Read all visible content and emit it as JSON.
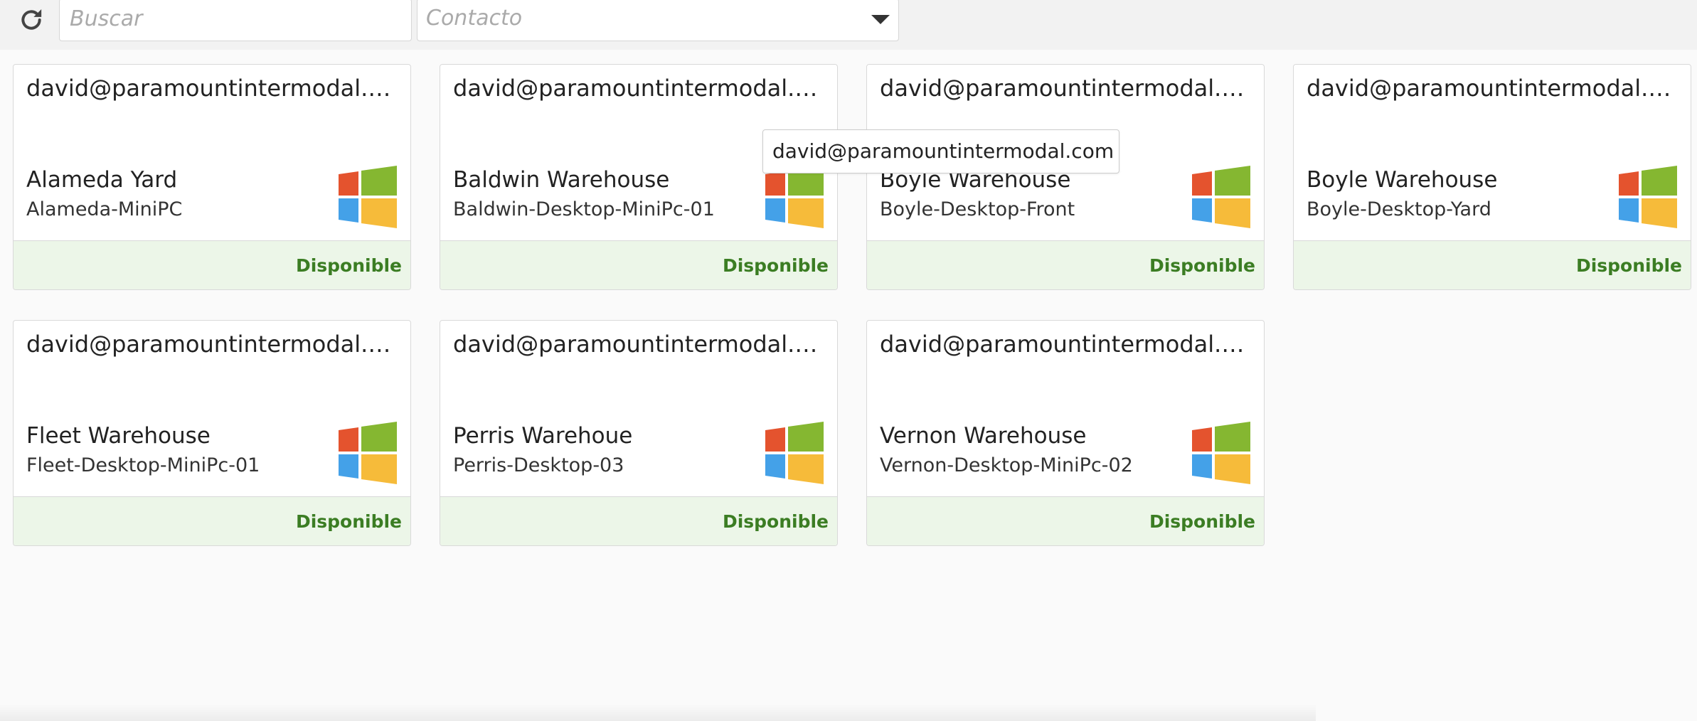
{
  "toolbar": {
    "refresh_icon": "refresh-icon",
    "search": {
      "placeholder": "Buscar",
      "value": ""
    },
    "contact_select": {
      "value": "Contacto",
      "icon": "chevron-down-icon"
    }
  },
  "tooltip": {
    "text": "david@paramountintermodal.com"
  },
  "colors": {
    "status_green": "#3b7d23",
    "footer_bg": "#ecf6e8",
    "win_red": "#e4532e",
    "win_green": "#85b731",
    "win_blue": "#44a1e8",
    "win_yellow": "#f6bb3a"
  },
  "devices": [
    {
      "email": "david@paramountintermodal.com",
      "location": "Alameda Yard",
      "hostname": "Alameda-MiniPC",
      "os_icon": "windows-icon",
      "status": "Disponible"
    },
    {
      "email": "david@paramountintermodal.com",
      "location": "Baldwin Warehouse",
      "hostname": "Baldwin-Desktop-MiniPc-01",
      "os_icon": "windows-icon",
      "status": "Disponible"
    },
    {
      "email": "david@paramountintermodal.com",
      "location": "Boyle Warehouse",
      "hostname": "Boyle-Desktop-Front",
      "os_icon": "windows-icon",
      "status": "Disponible"
    },
    {
      "email": "david@paramountintermodal.com",
      "location": "Boyle Warehouse",
      "hostname": "Boyle-Desktop-Yard",
      "os_icon": "windows-icon",
      "status": "Disponible"
    },
    {
      "email": "david@paramountintermodal.com",
      "location": "Fleet Warehouse",
      "hostname": "Fleet-Desktop-MiniPc-01",
      "os_icon": "windows-icon",
      "status": "Disponible"
    },
    {
      "email": "david@paramountintermodal.com",
      "location": "Perris Warehoue",
      "hostname": "Perris-Desktop-03",
      "os_icon": "windows-icon",
      "status": "Disponible"
    },
    {
      "email": "david@paramountintermodal.com",
      "location": "Vernon Warehouse",
      "hostname": "Vernon-Desktop-MiniPc-02",
      "os_icon": "windows-icon",
      "status": "Disponible"
    }
  ]
}
